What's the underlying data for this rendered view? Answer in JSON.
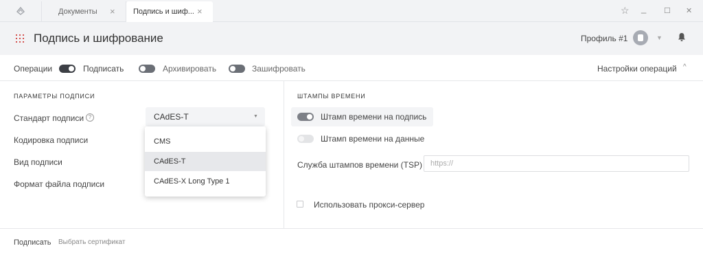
{
  "tabs": [
    {
      "label": "Документы"
    },
    {
      "label": "Подпись и шиф..."
    }
  ],
  "window": {
    "close": "×",
    "star": "☆",
    "minimize": "_",
    "maximize": "☐",
    "win_close": "✕"
  },
  "header": {
    "title": "Подпись и шифрование",
    "profile": "Профиль #1"
  },
  "operations": {
    "label": "Операции",
    "sign": "Подписать",
    "archive": "Архивировать",
    "encrypt": "Зашифровать",
    "settings": "Настройки операций"
  },
  "signature": {
    "section_title": "ПАРАМЕТРЫ ПОДПИСИ",
    "standard_label": "Стандарт подписи",
    "help": "?",
    "encoding_label": "Кодировка подписи",
    "type_label": "Вид подписи",
    "format_label": "Формат файла подписи",
    "standard_value": "CAdES-T",
    "options": [
      "CMS",
      "CAdES-T",
      "CAdES-X Long Type 1"
    ]
  },
  "timestamps": {
    "section_title": "ШТАМПЫ ВРЕМЕНИ",
    "on_signature": "Штамп времени на подпись",
    "on_data": "Штамп времени на данные",
    "tsp_label": "Служба штампов времени (TSP)",
    "tsp_placeholder": "https://",
    "proxy": "Использовать прокси-сервер"
  },
  "footer": {
    "sign_label": "Подписать",
    "select_cert": "Выбрать сертификат"
  },
  "colors": {
    "accent": "#d4514e",
    "toggle_on": "#3c3f45"
  }
}
